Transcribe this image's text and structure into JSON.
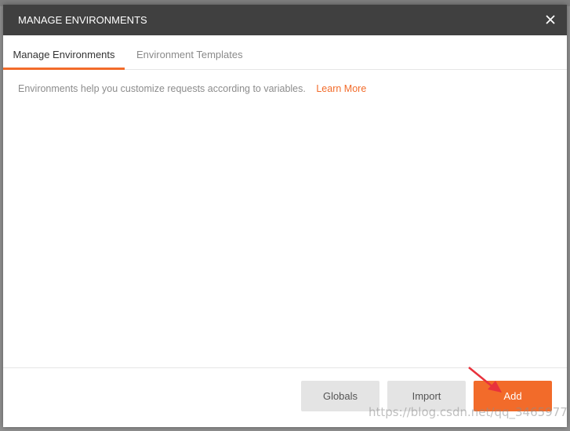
{
  "modal": {
    "title": "MANAGE ENVIRONMENTS",
    "close_icon": "close-icon"
  },
  "tabs": [
    {
      "label": "Manage Environments",
      "active": true
    },
    {
      "label": "Environment Templates",
      "active": false
    }
  ],
  "content": {
    "description": "Environments help you customize requests according to variables.",
    "learn_more": "Learn More"
  },
  "footer": {
    "globals_label": "Globals",
    "import_label": "Import",
    "add_label": "Add"
  },
  "watermark": "https://blog.csdn.net/qq_34659777",
  "colors": {
    "header_bg": "#404040",
    "accent": "#f26b2a",
    "secondary_button_bg": "#e4e4e4",
    "annotation_arrow": "#e8323c"
  }
}
